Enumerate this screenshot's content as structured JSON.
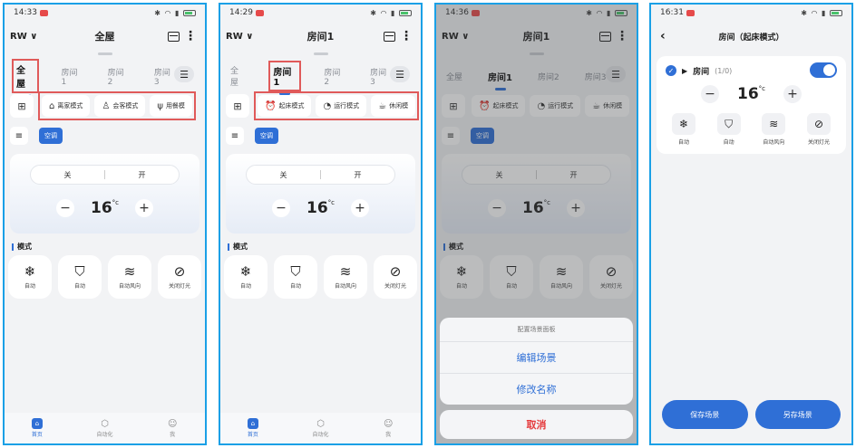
{
  "screens": [
    {
      "time": "14:33",
      "home_name": "RW ∨",
      "title": "全屋",
      "tabs": [
        "全屋",
        "房间1",
        "房间2",
        "房间3"
      ],
      "active_tab": 0,
      "scenes": [
        {
          "icon": "⌂",
          "label": "离家模式"
        },
        {
          "icon": "♙",
          "label": "会客模式"
        },
        {
          "icon": "ψ",
          "label": "用餐模"
        }
      ]
    },
    {
      "time": "14:29",
      "home_name": "RW ∨",
      "title": "房间1",
      "tabs": [
        "全屋",
        "房间1",
        "房间2",
        "房间3"
      ],
      "active_tab": 1,
      "scenes": [
        {
          "icon": "⏰",
          "label": "起床模式"
        },
        {
          "icon": "◔",
          "label": "运行模式"
        },
        {
          "icon": "☕",
          "label": "休闲模"
        }
      ]
    },
    {
      "time": "14:36",
      "home_name": "RW ∨",
      "title": "房间1",
      "tabs": [
        "全屋",
        "房间1",
        "房间2",
        "房间3"
      ],
      "active_tab": 1,
      "scenes": [
        {
          "icon": "⏰",
          "label": "起床模式"
        },
        {
          "icon": "◔",
          "label": "运行模式"
        },
        {
          "icon": "☕",
          "label": "休闲模"
        }
      ]
    }
  ],
  "device": {
    "chip": "空调",
    "off": "关",
    "on": "开",
    "temp": "16",
    "unit": "°c",
    "minus": "−",
    "plus": "+",
    "mode_section": "模式",
    "modes": [
      {
        "icon": "❄",
        "label": "自动"
      },
      {
        "icon": "⛉",
        "label": "自动"
      },
      {
        "icon": "≋",
        "label": "自动风向"
      },
      {
        "icon": "⊘",
        "label": "关闭灯光"
      }
    ]
  },
  "nav": [
    {
      "icon": "⌂",
      "label": "首页"
    },
    {
      "icon": "⬡",
      "label": "自动化"
    },
    {
      "icon": "☺",
      "label": "我"
    }
  ],
  "sheet": {
    "title": "配置场景面板",
    "edit": "编辑场景",
    "rename": "修改名称",
    "cancel": "取消"
  },
  "detail": {
    "time": "16:31",
    "title": "房间（起床模式）",
    "room_name": "房间",
    "room_count": "(1/0)",
    "save": "保存场景",
    "save_as": "另存场景"
  }
}
